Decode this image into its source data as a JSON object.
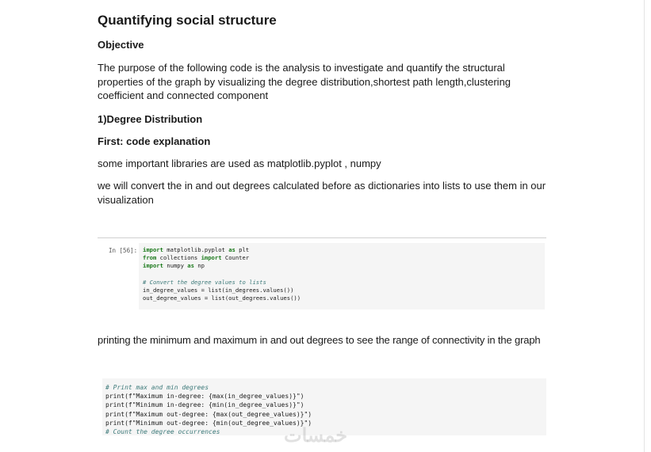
{
  "document": {
    "title": "Quantifying social structure",
    "objective_heading": "Objective",
    "objective_text": "The purpose of the following code is the analysis to investigate and quantify the structural properties of the graph by visualizing the degree distribution,shortest path length,clustering coefficient and connected component",
    "section_heading": "1)Degree Distribution",
    "subheading": "First: code explanation",
    "libraries_text": "some important libraries are used as matplotlib.pyplot , numpy",
    "convert_text": "we will convert the in and out degrees calculated before as dictionaries into lists to use them in our visualization",
    "printing_text": "printing the minimum and maximum in and out degrees to see the range of connectivity in the graph"
  },
  "code_cell_1": {
    "prompt": "In [56]:",
    "lines": [
      "import matplotlib.pyplot as plt",
      "from collections import Counter",
      "import numpy as np",
      "",
      "# Convert the degree values to lists",
      "in_degree_values = list(in_degrees.values())",
      "out_degree_values = list(out_degrees.values())"
    ]
  },
  "code_cell_2": {
    "lines": [
      "# Print max and min degrees",
      "print(f\"Maximum in-degree: {max(in_degree_values)}\")",
      "print(f\"Minimum in-degree: {min(in_degree_values)}\")",
      "print(f\"Maximum out-degree: {max(out_degree_values)}\")",
      "print(f\"Minimum out-degree: {min(out_degree_values)}\")",
      "# Count the degree occurrences"
    ]
  },
  "watermark": "خمسات"
}
